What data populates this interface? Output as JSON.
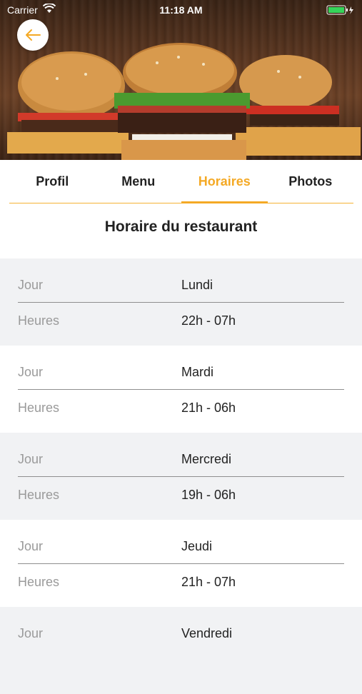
{
  "status_bar": {
    "carrier": "Carrier",
    "time": "11:18 AM"
  },
  "tabs": [
    {
      "label": "Profil",
      "active": false
    },
    {
      "label": "Menu",
      "active": false
    },
    {
      "label": "Horaires",
      "active": true
    },
    {
      "label": "Photos",
      "active": false
    }
  ],
  "section_title": "Horaire du restaurant",
  "schedule": [
    {
      "day_label": "Jour",
      "day": "Lundi",
      "hours_label": "Heures",
      "hours": "22h - 07h"
    },
    {
      "day_label": "Jour",
      "day": "Mardi",
      "hours_label": "Heures",
      "hours": "21h - 06h"
    },
    {
      "day_label": "Jour",
      "day": "Mercredi",
      "hours_label": "Heures",
      "hours": "19h - 06h"
    },
    {
      "day_label": "Jour",
      "day": "Jeudi",
      "hours_label": "Heures",
      "hours": "21h - 07h"
    },
    {
      "day_label": "Jour",
      "day": "Vendredi",
      "hours_label": "Heures",
      "hours": ""
    }
  ],
  "colors": {
    "accent": "#f4a925",
    "alt_row": "#f1f2f4"
  },
  "icons": {
    "back": "arrow-left-icon",
    "wifi": "wifi-icon",
    "battery": "battery-icon"
  }
}
